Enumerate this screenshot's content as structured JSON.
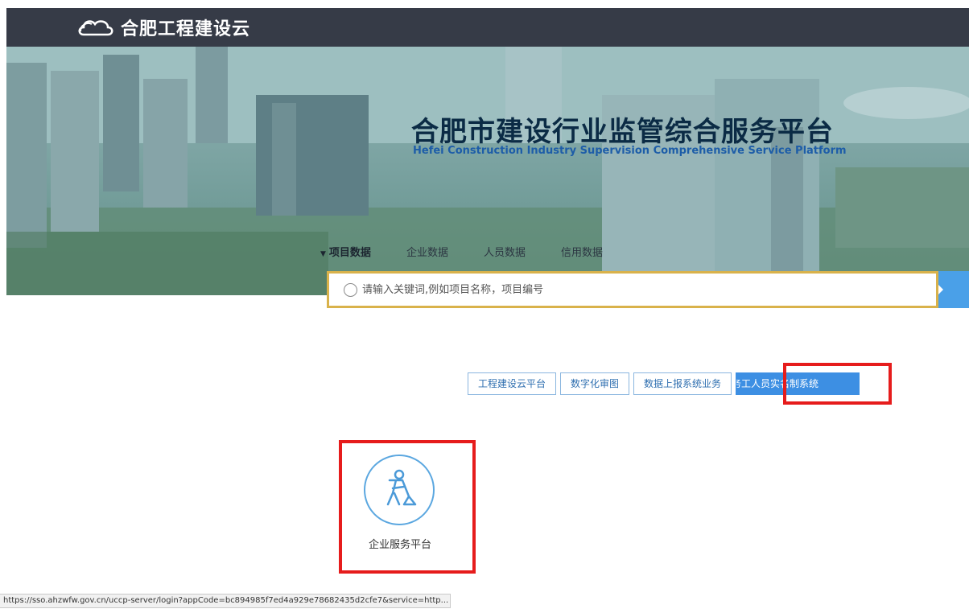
{
  "header": {
    "logo_text": "合肥工程建设云"
  },
  "banner": {
    "title": "合肥市建设行业监管综合服务平台",
    "subtitle": "Hefei Construction Industry Supervision Comprehensive Service Platform"
  },
  "tabs": [
    {
      "label": "项目数据",
      "active": true
    },
    {
      "label": "企业数据"
    },
    {
      "label": "人员数据"
    },
    {
      "label": "信用数据"
    }
  ],
  "search": {
    "placeholder": "请输入关键词,例如项目名称，项目编号"
  },
  "links": [
    {
      "label": "工程建设云平台"
    },
    {
      "label": "数字化审图"
    },
    {
      "label": "数据上报系统业务"
    },
    {
      "label": "务工人员实名制系统"
    }
  ],
  "services": [
    {
      "label": "企业服务平台",
      "icon": "worker-shovel-icon"
    }
  ],
  "status_url": "https://sso.ahzwfw.gov.cn/uccp-server/login?appCode=bc894985f7ed4a929e78682435d2cfe7&service=http...",
  "colors": {
    "accent": "#3d8fe3",
    "highlight": "#e61c1c",
    "search_border": "#d9b24b",
    "topbar": "#363b47"
  }
}
